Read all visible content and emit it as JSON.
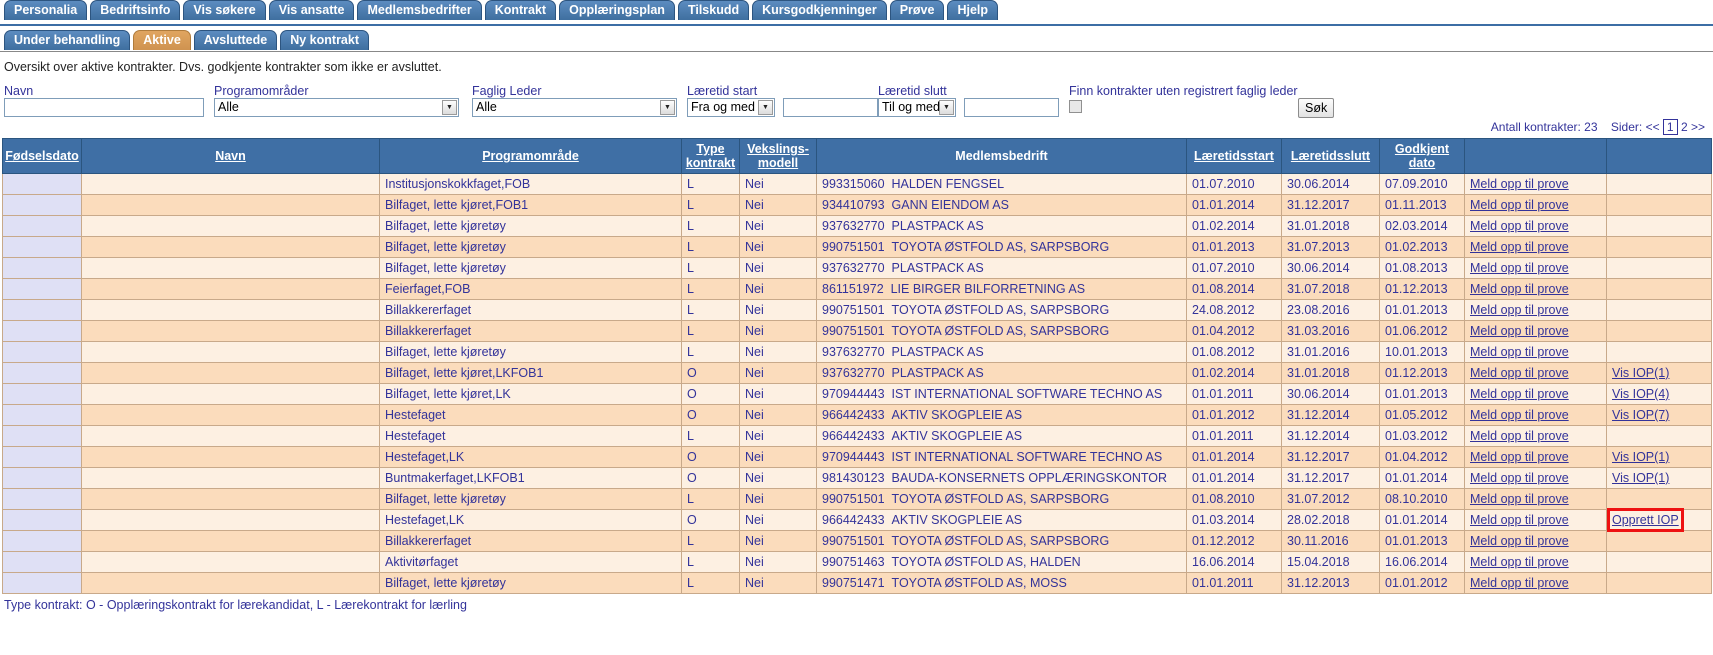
{
  "nav": {
    "main_tabs": [
      {
        "label": "Personalia"
      },
      {
        "label": "Bedriftsinfo"
      },
      {
        "label": "Vis søkere"
      },
      {
        "label": "Vis ansatte"
      },
      {
        "label": "Medlemsbedrifter"
      },
      {
        "label": "Kontrakt"
      },
      {
        "label": "Opplæringsplan"
      },
      {
        "label": "Tilskudd"
      },
      {
        "label": "Kursgodkjenninger"
      },
      {
        "label": "Prøve"
      },
      {
        "label": "Hjelp"
      }
    ],
    "sub_tabs": [
      {
        "label": "Under behandling",
        "active": false
      },
      {
        "label": "Aktive",
        "active": true
      },
      {
        "label": "Avsluttede",
        "active": false
      },
      {
        "label": "Ny kontrakt",
        "active": false
      }
    ]
  },
  "page": {
    "description": "Oversikt over aktive kontrakter. Dvs. godkjente kontrakter som ikke er avsluttet.",
    "footer_note": "Type kontrakt: O - Opplæringskontrakt for lærekandidat, L - Lærekontrakt for lærling"
  },
  "filters": {
    "navn": {
      "label": "Navn",
      "value": "",
      "placeholder": ""
    },
    "programomrader": {
      "label": "Programområder",
      "value": "Alle"
    },
    "faglig_leder": {
      "label": "Faglig Leder",
      "value": "Alle"
    },
    "laeretid_start": {
      "label": "Læretid start",
      "operator": "Fra og med",
      "value": ""
    },
    "laeretid_slutt": {
      "label": "Læretid slutt",
      "operator": "Til og med",
      "value": ""
    },
    "uten_faglig_leder": {
      "label": "Finn kontrakter uten registrert faglig leder",
      "checked": false
    },
    "search_button": "Søk"
  },
  "pager": {
    "count_label": "Antall kontrakter: 23",
    "pages_label": "Sider:",
    "prev": "<<",
    "page1": "1",
    "page2": "2",
    "next": ">>"
  },
  "table": {
    "headers": {
      "fodselsdato": "Fødselsdato",
      "navn": "Navn",
      "programomrade": "Programområde",
      "type_kontrakt_l1": "Type",
      "type_kontrakt_l2": "kontrakt",
      "vekslings_l1": "Vekslings-",
      "vekslings_l2": "modell",
      "medlemsbedrift": "Medlemsbedrift",
      "laeretidsstart": "Læretidsstart",
      "laeretidsslutt": "Læretidsslutt",
      "godkjent_l1": "Godkjent",
      "godkjent_l2": "dato",
      "action1": "",
      "action2": ""
    },
    "rows": [
      {
        "fodselsdato": "",
        "navn": "",
        "programomrade": "Institusjonskokkfaget,FOB",
        "type": "L",
        "veksling": "Nei",
        "orgnr": "993315060",
        "bedrift": "HALDEN FENGSEL",
        "start": "01.07.2010",
        "slutt": "30.06.2014",
        "godkjent": "07.09.2010",
        "action1": "Meld opp til prove",
        "action2": "",
        "highlight": false
      },
      {
        "fodselsdato": "",
        "navn": "",
        "programomrade": "Bilfaget, lette kjøret,FOB1",
        "type": "L",
        "veksling": "Nei",
        "orgnr": "934410793",
        "bedrift": "GANN EIENDOM AS",
        "start": "01.01.2014",
        "slutt": "31.12.2017",
        "godkjent": "01.11.2013",
        "action1": "Meld opp til prove",
        "action2": "",
        "highlight": false
      },
      {
        "fodselsdato": "",
        "navn": "",
        "programomrade": "Bilfaget, lette kjøretøy",
        "type": "L",
        "veksling": "Nei",
        "orgnr": "937632770",
        "bedrift": "PLASTPACK AS",
        "start": "01.02.2014",
        "slutt": "31.01.2018",
        "godkjent": "02.03.2014",
        "action1": "Meld opp til prove",
        "action2": "",
        "highlight": false
      },
      {
        "fodselsdato": "",
        "navn": "",
        "programomrade": "Bilfaget, lette kjøretøy",
        "type": "L",
        "veksling": "Nei",
        "orgnr": "990751501",
        "bedrift": "TOYOTA ØSTFOLD AS, SARPSBORG",
        "start": "01.01.2013",
        "slutt": "31.07.2013",
        "godkjent": "01.02.2013",
        "action1": "Meld opp til prove",
        "action2": "",
        "highlight": false
      },
      {
        "fodselsdato": "",
        "navn": "",
        "programomrade": "Bilfaget, lette kjøretøy",
        "type": "L",
        "veksling": "Nei",
        "orgnr": "937632770",
        "bedrift": "PLASTPACK AS",
        "start": "01.07.2010",
        "slutt": "30.06.2014",
        "godkjent": "01.08.2013",
        "action1": "Meld opp til prove",
        "action2": "",
        "highlight": false
      },
      {
        "fodselsdato": "",
        "navn": "",
        "programomrade": "Feierfaget,FOB",
        "type": "L",
        "veksling": "Nei",
        "orgnr": "861151972",
        "bedrift": "LIE BIRGER BILFORRETNING AS",
        "start": "01.08.2014",
        "slutt": "31.07.2018",
        "godkjent": "01.12.2013",
        "action1": "Meld opp til prove",
        "action2": "",
        "highlight": false
      },
      {
        "fodselsdato": "",
        "navn": "",
        "programomrade": "Billakkererfaget",
        "type": "L",
        "veksling": "Nei",
        "orgnr": "990751501",
        "bedrift": "TOYOTA ØSTFOLD AS, SARPSBORG",
        "start": "24.08.2012",
        "slutt": "23.08.2016",
        "godkjent": "01.01.2013",
        "action1": "Meld opp til prove",
        "action2": "",
        "highlight": false
      },
      {
        "fodselsdato": "",
        "navn": "",
        "programomrade": "Billakkererfaget",
        "type": "L",
        "veksling": "Nei",
        "orgnr": "990751501",
        "bedrift": "TOYOTA ØSTFOLD AS, SARPSBORG",
        "start": "01.04.2012",
        "slutt": "31.03.2016",
        "godkjent": "01.06.2012",
        "action1": "Meld opp til prove",
        "action2": "",
        "highlight": false
      },
      {
        "fodselsdato": "",
        "navn": "",
        "programomrade": "Bilfaget, lette kjøretøy",
        "type": "L",
        "veksling": "Nei",
        "orgnr": "937632770",
        "bedrift": "PLASTPACK AS",
        "start": "01.08.2012",
        "slutt": "31.01.2016",
        "godkjent": "10.01.2013",
        "action1": "Meld opp til prove",
        "action2": "",
        "highlight": false
      },
      {
        "fodselsdato": "",
        "navn": "",
        "programomrade": "Bilfaget, lette kjøret,LKFOB1",
        "type": "O",
        "veksling": "Nei",
        "orgnr": "937632770",
        "bedrift": "PLASTPACK AS",
        "start": "01.02.2014",
        "slutt": "31.01.2018",
        "godkjent": "01.12.2013",
        "action1": "Meld opp til prove",
        "action2": "Vis IOP(1)",
        "highlight": false
      },
      {
        "fodselsdato": "",
        "navn": "",
        "programomrade": "Bilfaget, lette kjøret,LK",
        "type": "O",
        "veksling": "Nei",
        "orgnr": "970944443",
        "bedrift": "IST INTERNATIONAL SOFTWARE TECHNO AS",
        "start": "01.01.2011",
        "slutt": "30.06.2014",
        "godkjent": "01.01.2013",
        "action1": "Meld opp til prove",
        "action2": "Vis IOP(4)",
        "highlight": false
      },
      {
        "fodselsdato": "",
        "navn": "",
        "programomrade": "Hestefaget",
        "type": "O",
        "veksling": "Nei",
        "orgnr": "966442433",
        "bedrift": "AKTIV SKOGPLEIE AS",
        "start": "01.01.2012",
        "slutt": "31.12.2014",
        "godkjent": "01.05.2012",
        "action1": "Meld opp til prove",
        "action2": "Vis IOP(7)",
        "highlight": false
      },
      {
        "fodselsdato": "",
        "navn": "",
        "programomrade": "Hestefaget",
        "type": "L",
        "veksling": "Nei",
        "orgnr": "966442433",
        "bedrift": "AKTIV SKOGPLEIE AS",
        "start": "01.01.2011",
        "slutt": "31.12.2014",
        "godkjent": "01.03.2012",
        "action1": "Meld opp til prove",
        "action2": "",
        "highlight": false
      },
      {
        "fodselsdato": "",
        "navn": "",
        "programomrade": "Hestefaget,LK",
        "type": "O",
        "veksling": "Nei",
        "orgnr": "970944443",
        "bedrift": "IST INTERNATIONAL SOFTWARE TECHNO AS",
        "start": "01.01.2014",
        "slutt": "31.12.2017",
        "godkjent": "01.04.2012",
        "action1": "Meld opp til prove",
        "action2": "Vis IOP(1)",
        "highlight": false
      },
      {
        "fodselsdato": "",
        "navn": "",
        "programomrade": "Buntmakerfaget,LKFOB1",
        "type": "O",
        "veksling": "Nei",
        "orgnr": "981430123",
        "bedrift": "BAUDA-KONSERNETS OPPLÆRINGSKONTOR",
        "start": "01.01.2014",
        "slutt": "31.12.2017",
        "godkjent": "01.01.2014",
        "action1": "Meld opp til prove",
        "action2": "Vis IOP(1)",
        "highlight": false
      },
      {
        "fodselsdato": "",
        "navn": "",
        "programomrade": "Bilfaget, lette kjøretøy",
        "type": "L",
        "veksling": "Nei",
        "orgnr": "990751501",
        "bedrift": "TOYOTA ØSTFOLD AS, SARPSBORG",
        "start": "01.08.2010",
        "slutt": "31.07.2012",
        "godkjent": "08.10.2010",
        "action1": "Meld opp til prove",
        "action2": "",
        "highlight": false
      },
      {
        "fodselsdato": "",
        "navn": "",
        "programomrade": "Hestefaget,LK",
        "type": "O",
        "veksling": "Nei",
        "orgnr": "966442433",
        "bedrift": "AKTIV SKOGPLEIE AS",
        "start": "01.03.2014",
        "slutt": "28.02.2018",
        "godkjent": "01.01.2014",
        "action1": "Meld opp til prove",
        "action2": "Opprett IOP",
        "highlight": true
      },
      {
        "fodselsdato": "",
        "navn": "",
        "programomrade": "Billakkererfaget",
        "type": "L",
        "veksling": "Nei",
        "orgnr": "990751501",
        "bedrift": "TOYOTA ØSTFOLD AS, SARPSBORG",
        "start": "01.12.2012",
        "slutt": "30.11.2016",
        "godkjent": "01.01.2013",
        "action1": "Meld opp til prove",
        "action2": "",
        "highlight": false
      },
      {
        "fodselsdato": "",
        "navn": "",
        "programomrade": "Aktivitørfaget",
        "type": "L",
        "veksling": "Nei",
        "orgnr": "990751463",
        "bedrift": "TOYOTA ØSTFOLD AS, HALDEN",
        "start": "16.06.2014",
        "slutt": "15.04.2018",
        "godkjent": "16.06.2014",
        "action1": "Meld opp til prove",
        "action2": "",
        "highlight": false
      },
      {
        "fodselsdato": "",
        "navn": "",
        "programomrade": "Bilfaget, lette kjøretøy",
        "type": "L",
        "veksling": "Nei",
        "orgnr": "990751471",
        "bedrift": "TOYOTA ØSTFOLD AS, MOSS",
        "start": "01.01.2011",
        "slutt": "31.12.2013",
        "godkjent": "01.01.2012",
        "action1": "Meld opp til prove",
        "action2": "",
        "highlight": false
      }
    ]
  },
  "colors": {
    "nav_blue": "#3f6fa5",
    "active_tab": "#cf9350",
    "row_odd": "#fdf0e2",
    "row_even": "#fbdcbc",
    "fodsel_col": "#dfe0f5",
    "link": "#33339a",
    "highlight_box": "#ee1111"
  }
}
